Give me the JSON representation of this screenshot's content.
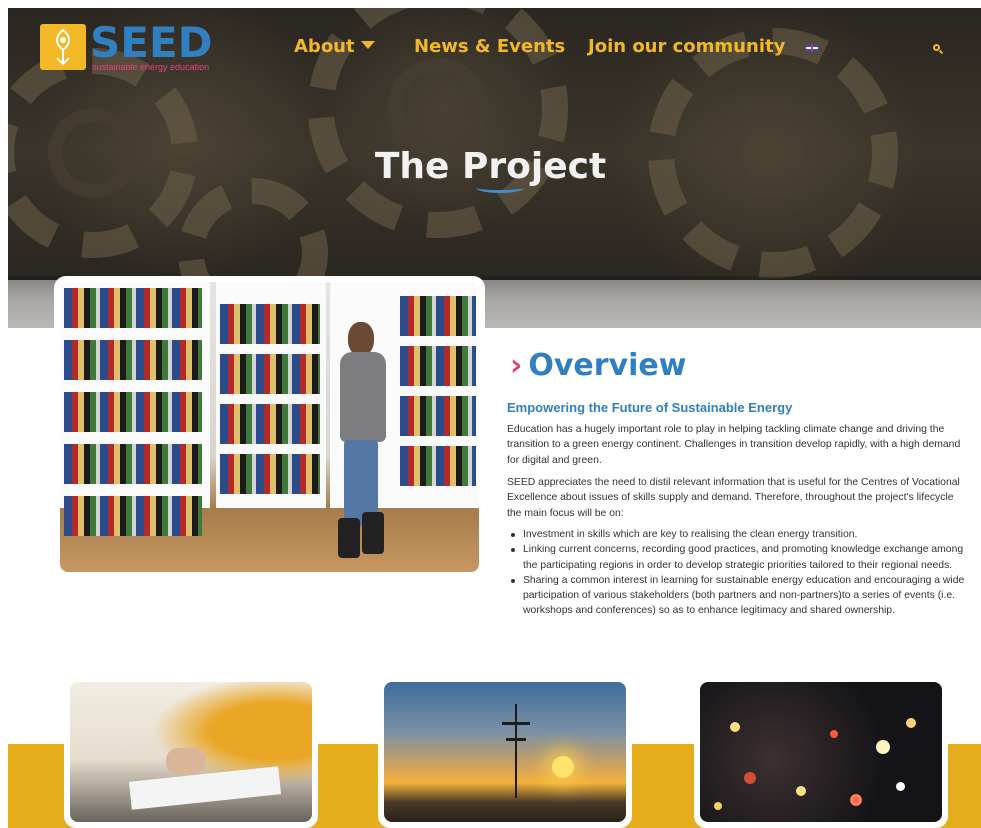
{
  "brand": {
    "logo_word": "SEED",
    "logo_tagline": "sustainable energy education",
    "colors": {
      "accent_yellow": "#f2b826",
      "brand_blue": "#2f7fc1",
      "accent_pink": "#e0457b"
    }
  },
  "nav": {
    "items": [
      {
        "label": "About",
        "has_dropdown": true
      },
      {
        "label": "News & Events",
        "has_dropdown": false
      },
      {
        "label": "Join our community",
        "has_dropdown": false
      }
    ],
    "language_icon": "uk-flag-icon",
    "search_icon": "search-icon"
  },
  "hero": {
    "title": "The Project"
  },
  "overview": {
    "heading": "Overview",
    "heading_icon": "chevron-right-icon",
    "subheading": "Empowering the Future of Sustainable Energy",
    "paragraphs": [
      "Education has a hugely important role to play in helping tackling climate change and driving the transition to a green energy continent. Challenges in transition develop rapidly, with a high demand for digital and green.",
      "SEED appreciates the need to distil relevant information that is useful for the Centres of Vocational Excellence about issues of skills supply and demand. Therefore, throughout the project's lifecycle the main focus will be on:"
    ],
    "bullets": [
      "Investment in skills which are key to realising the clean energy transition.",
      "Linking current concerns, recording good practices, and promoting knowledge exchange among the participating regions in order to develop strategic priorities tailored to their regional needs.",
      "Sharing a common interest in learning for sustainable energy education and encouraging a wide participation of various stakeholders (both partners and non-partners)to a series of events (i.e. workshops and conferences) so as to enhance legitimacy and shared ownership."
    ]
  }
}
